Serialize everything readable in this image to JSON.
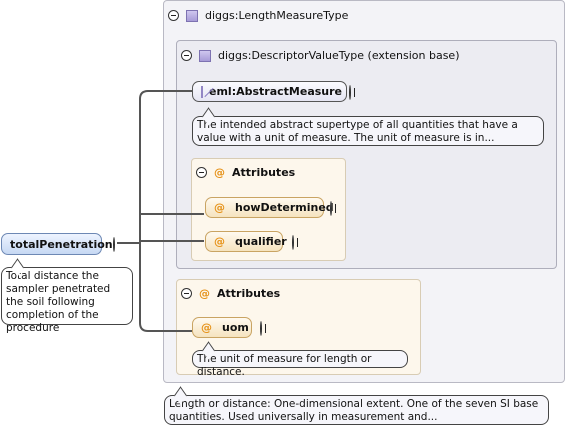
{
  "outer_type": {
    "name": "diggs:LengthMeasureType",
    "documentation": "Length or distance: One-dimensional extent. One of the seven SI base quantities. Used universally in measurement and..."
  },
  "base_type": {
    "name": "diggs:DescriptorValueType (extension base)",
    "element": {
      "name": "eml:AbstractMeasure",
      "documentation": "The intended abstract supertype of all quantities that have a value with a unit of measure. The unit of measure is in..."
    },
    "attributes": {
      "title": "Attributes",
      "items": [
        {
          "name": "howDetermined"
        },
        {
          "name": "qualifier"
        }
      ]
    }
  },
  "attributes": {
    "title": "Attributes",
    "items": [
      {
        "name": "uom",
        "documentation": "The unit of measure for length or distance."
      }
    ]
  },
  "root_element": {
    "name": "totalPenetration",
    "documentation": "Total distance the sampler penetrated the soil following completion of the procedure"
  },
  "icons": {
    "attribute_marker": "@",
    "type_icon": "complex-type-icon",
    "abstract_icon": "abstract-element-icon"
  },
  "colors": {
    "type_icon": "#a79bd7",
    "attribute_marker": "#e69219",
    "element_node": "#c6d8f3",
    "attribute_panel": "#fdf7ec"
  }
}
